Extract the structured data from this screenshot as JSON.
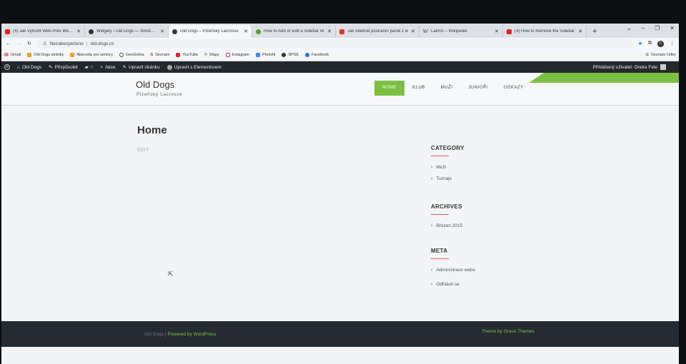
{
  "browser": {
    "tabs": [
      {
        "title": "(4) Jak Vytvořit Web Přes WordP",
        "favicon_color": "#e02020"
      },
      {
        "title": "Widgety ‹ Old Dogs — WordPres",
        "favicon_color": "#333333"
      },
      {
        "title": "Old Dogs – Plzeňský Lacrosse",
        "favicon_color": "#333333"
      },
      {
        "title": "How to Add or Edit a Sidebar W",
        "favicon_color": "#5aa02c"
      },
      {
        "title": "Jak odebrat postranní panel z w",
        "favicon_color": "#d83a2a"
      },
      {
        "title": "Lakros – Wikipedie",
        "favicon_color": "#666666"
      },
      {
        "title": "(4) How to Remove the Sidebar",
        "favicon_color": "#e02020"
      }
    ],
    "new_tab": "+",
    "window_controls": [
      "⌄",
      "–",
      "❐",
      "✕"
    ],
    "security": "Nezabezpečeno",
    "url": "old-dogs.cz",
    "profile_initial": "C",
    "bookmarks": [
      {
        "label": "Gmail",
        "color": "#d93025"
      },
      {
        "label": "Old Dogs stránky",
        "color": "#e8a317"
      },
      {
        "label": "Abeceda pro seniory",
        "color": "#e8a317"
      },
      {
        "label": "GeoGebra",
        "color": "#444444"
      },
      {
        "label": "Seznam",
        "color": "#cc2222"
      },
      {
        "label": "YouTube",
        "color": "#e02020"
      },
      {
        "label": "Mapy",
        "color": "#444444"
      },
      {
        "label": "Instagram",
        "color": "#c13584"
      },
      {
        "label": "Přeložit",
        "color": "#4285f4"
      },
      {
        "label": "SPSE",
        "color": "#333333"
      },
      {
        "label": "Facebook",
        "color": "#1877f2"
      }
    ],
    "reading_list": "Seznam četby"
  },
  "wp_admin_bar": {
    "site": "Old Dogs",
    "customize": "Přizpůsobit",
    "comments_count": "0",
    "new": "Akce",
    "edit_page": "Upravit stránku",
    "edit_elementor": "Upravit s Elementorem",
    "user": "Přihlášený uživatel: Ondra Fele"
  },
  "site": {
    "title": "Old Dogs",
    "tagline": "Plzeňský Lacrosse",
    "nav": [
      "HOME",
      "KLUB",
      "MUŽI",
      "JUNIOŘI",
      "ODKAZY"
    ],
    "accent_color": "#7cc043"
  },
  "content": {
    "page_title": "Home",
    "edit_link": "EDIT"
  },
  "sidebar": {
    "category": {
      "title": "CATEGORY",
      "items": [
        "Muži",
        "Turnaje"
      ]
    },
    "archives": {
      "title": "ARCHIVES",
      "items": [
        "Březen 2015"
      ]
    },
    "meta": {
      "title": "META",
      "items": [
        "Administrace webu",
        "Odhlásit se"
      ]
    }
  },
  "footer": {
    "site_name": "Old Dogs",
    "separator": "|",
    "powered_by": "Powered by WordPress",
    "theme_credit": "Theme by Grace Themes"
  }
}
